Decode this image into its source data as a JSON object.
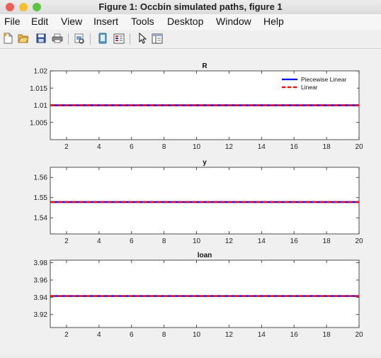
{
  "window": {
    "title": "Figure 1: Occbin simulated paths, figure 1",
    "traffic_light_colors": [
      "#ec5f57",
      "#f5bf2f",
      "#5dc440"
    ]
  },
  "menubar": {
    "items": [
      "File",
      "Edit",
      "View",
      "Insert",
      "Tools",
      "Desktop",
      "Window",
      "Help"
    ]
  },
  "toolbar": {
    "icons": [
      "new-figure-icon",
      "open-file-icon",
      "save-icon",
      "print-icon",
      "print-preview-icon",
      "link-plot-icon",
      "insert-colorbar-icon",
      "pointer-arrow-icon",
      "property-inspector-icon"
    ]
  },
  "legend": {
    "entries": [
      {
        "label": "Piecewise Linear",
        "color": "#0000ff",
        "style": "solid"
      },
      {
        "label": "Linear",
        "color": "#ff0000",
        "style": "dashed"
      }
    ]
  },
  "chart_data": [
    {
      "type": "line",
      "title": "R",
      "xlabel": "",
      "ylabel": "",
      "xlim": [
        1,
        20
      ],
      "ylim": [
        1.0,
        1.02
      ],
      "xticks": [
        2,
        4,
        6,
        8,
        10,
        12,
        14,
        16,
        18,
        20
      ],
      "yticks": [
        1.005,
        1.01,
        1.015,
        1.02
      ],
      "ytick_labels": [
        "1.005",
        "1.01",
        "1.015",
        "1.02"
      ],
      "x": [
        1,
        20
      ],
      "series": [
        {
          "name": "Piecewise Linear",
          "values": [
            1.01,
            1.01
          ]
        },
        {
          "name": "Linear",
          "values": [
            1.01,
            1.01
          ]
        }
      ],
      "legend": "top-right"
    },
    {
      "type": "line",
      "title": "y",
      "xlabel": "",
      "ylabel": "",
      "xlim": [
        1,
        20
      ],
      "ylim": [
        1.532,
        1.565
      ],
      "xticks": [
        2,
        4,
        6,
        8,
        10,
        12,
        14,
        16,
        18,
        20
      ],
      "yticks": [
        1.54,
        1.55,
        1.56
      ],
      "ytick_labels": [
        "1.54",
        "1.55",
        "1.56"
      ],
      "x": [
        1,
        20
      ],
      "series": [
        {
          "name": "Piecewise Linear",
          "values": [
            1.5478,
            1.5478
          ]
        },
        {
          "name": "Linear",
          "values": [
            1.5478,
            1.5478
          ]
        }
      ]
    },
    {
      "type": "line",
      "title": "loan",
      "xlabel": "",
      "ylabel": "",
      "xlim": [
        1,
        20
      ],
      "ylim": [
        3.905,
        3.983
      ],
      "xticks": [
        2,
        4,
        6,
        8,
        10,
        12,
        14,
        16,
        18,
        20
      ],
      "yticks": [
        3.92,
        3.94,
        3.96,
        3.98
      ],
      "ytick_labels": [
        "3.92",
        "3.94",
        "3.96",
        "3.98"
      ],
      "x": [
        1,
        20
      ],
      "series": [
        {
          "name": "Piecewise Linear",
          "values": [
            3.9415,
            3.9415
          ]
        },
        {
          "name": "Linear",
          "values": [
            3.9415,
            3.9415
          ]
        }
      ]
    }
  ]
}
